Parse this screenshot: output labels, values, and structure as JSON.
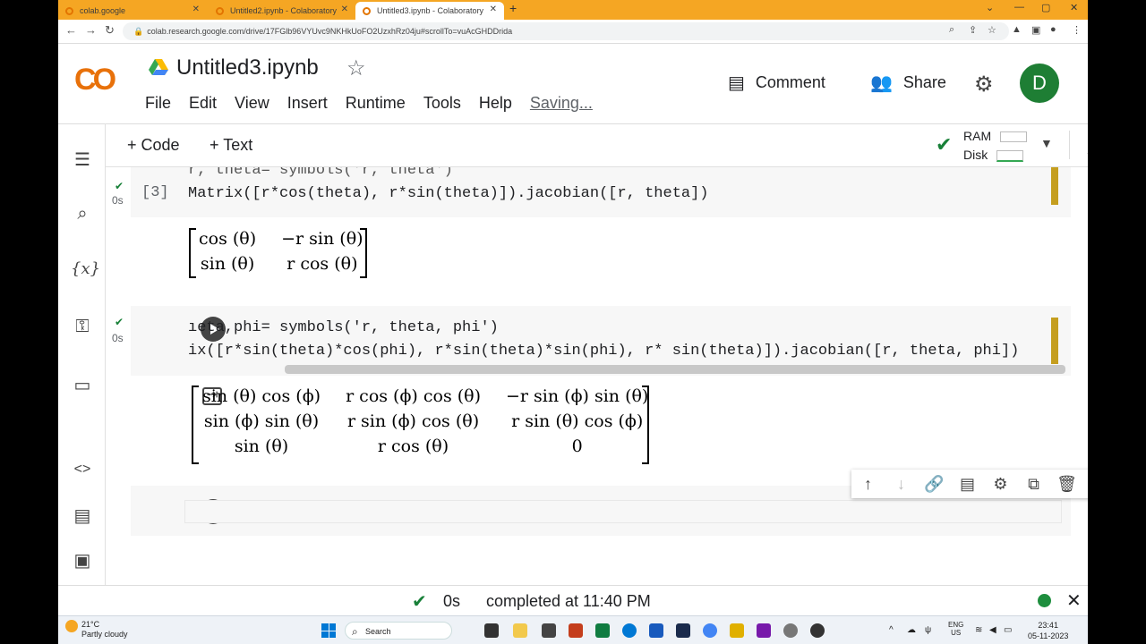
{
  "browser": {
    "tabs": [
      {
        "title": "colab.google",
        "active": false
      },
      {
        "title": "Untitled2.ipynb - Colaboratory",
        "active": false
      },
      {
        "title": "Untitled3.ipynb - Colaboratory",
        "active": true
      }
    ],
    "new_tab": "+",
    "url": "colab.research.google.com/drive/17FGlb96VYUvc9NKHkUoFO2UzxhRz04ju#scrollTo=vuAcGHDDrida"
  },
  "header": {
    "logo_text_left": "C",
    "logo_text_right": "O",
    "notebook_title": "Untitled3.ipynb",
    "menu": [
      "File",
      "Edit",
      "View",
      "Insert",
      "Runtime",
      "Tools",
      "Help"
    ],
    "saving": "Saving...",
    "comment_label": "Comment",
    "share_label": "Share",
    "avatar_letter": "D",
    "avatar_color": "#1e7e34"
  },
  "toolbar": {
    "code_label": "+ Code",
    "text_label": "+ Text",
    "ram_label": "RAM",
    "disk_label": "Disk"
  },
  "cells": {
    "cell1": {
      "exec_count": "[3]",
      "status_time": "0s",
      "line1": "r, theta= symbols('r, theta')",
      "line2": "Matrix([r*cos(theta), r*sin(theta)]).jacobian([r, theta])",
      "output": [
        [
          "cos (θ)",
          "−r sin (θ)"
        ],
        [
          "sin (θ)",
          "r cos (θ)"
        ]
      ]
    },
    "cell2": {
      "status_time": "0s",
      "line1": "ıeta,phi= symbols('r, theta, phi')",
      "line2": "ix([r*sin(theta)*cos(phi), r*sin(theta)*sin(phi), r* sin(theta)]).jacobian([r, theta, phi])",
      "output": [
        [
          "sin (θ) cos (ϕ)",
          "r cos (ϕ) cos (θ)",
          "−r sin (ϕ) sin (θ)"
        ],
        [
          "sin (ϕ) sin (θ)",
          "r sin (ϕ) cos (θ)",
          "r sin (θ) cos (ϕ)"
        ],
        [
          "sin (θ)",
          "r cos (θ)",
          "0"
        ]
      ]
    }
  },
  "statusbar": {
    "time": "0s",
    "text": "completed at 11:40 PM"
  },
  "taskbar": {
    "temperature": "21°C",
    "weather": "Partly cloudy",
    "search": "Search",
    "lang1": "ENG",
    "lang2": "US",
    "time": "23:41",
    "date": "05-11-2023"
  }
}
